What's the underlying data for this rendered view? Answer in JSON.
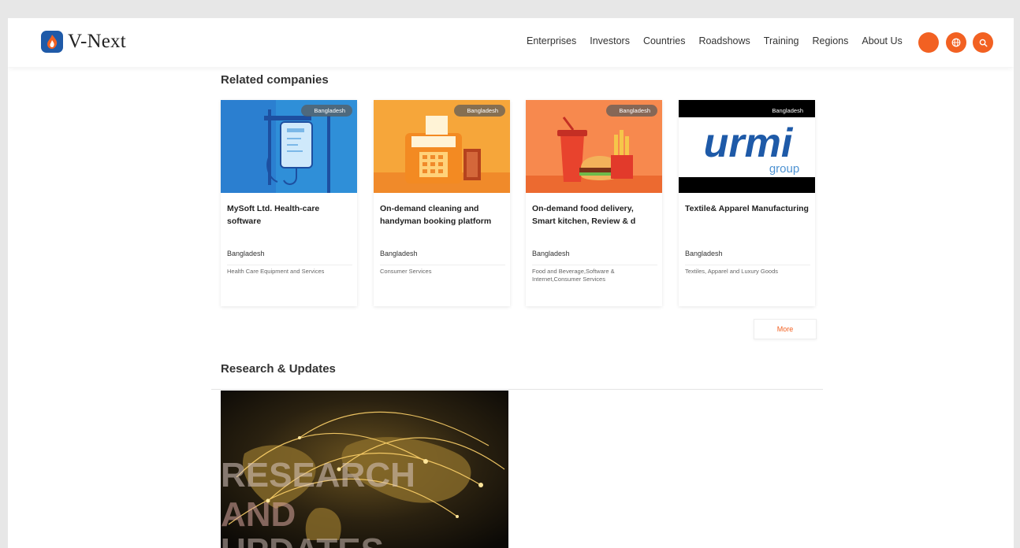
{
  "brand": {
    "name": "V-Next",
    "accent": "#f26122",
    "logo_color": "#1f5aa8"
  },
  "nav": {
    "items": [
      "Enterprises",
      "Investors",
      "Countries",
      "Roadshows",
      "Training",
      "Regions",
      "About Us"
    ]
  },
  "header_icons": [
    "user-icon",
    "globe-icon",
    "search-icon"
  ],
  "related": {
    "title": "Related companies",
    "cards": [
      {
        "badge": "Bangladesh",
        "title": "MySoft Ltd. Health-care software",
        "country": "Bangladesh",
        "sector": "Health Care Equipment and Services",
        "image": "health-care-illustration"
      },
      {
        "badge": "Bangladesh",
        "title": "On-demand cleaning and handyman booking platform",
        "country": "Bangladesh",
        "sector": "Consumer Services",
        "image": "cash-register-illustration"
      },
      {
        "badge": "Bangladesh",
        "title": "On-demand food delivery, Smart kitchen, Review & d",
        "country": "Bangladesh",
        "sector": "Food and Beverage,Software & Internet,Consumer Services",
        "image": "fast-food-illustration"
      },
      {
        "badge": "Bangladesh",
        "title": "Textile& Apparel Manufacturing",
        "country": "Bangladesh",
        "sector": "Textiles, Apparel and Luxury Goods",
        "image": "urmi-group-logo",
        "logo_word": "urmi",
        "logo_sub": "group"
      }
    ],
    "more_label": "More"
  },
  "research": {
    "title": "Research & Updates",
    "image_text": [
      "RESEARCH",
      "AND",
      "UPDATES"
    ]
  }
}
